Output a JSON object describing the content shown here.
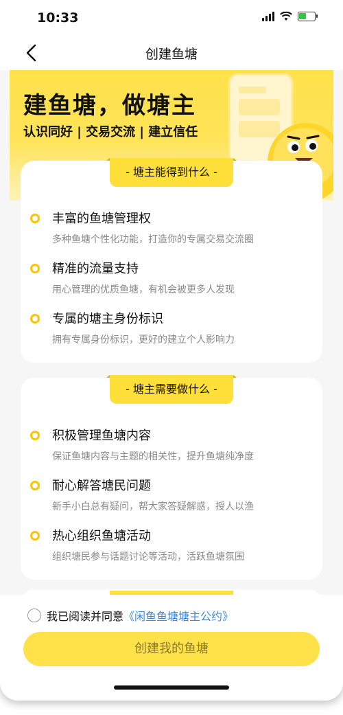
{
  "status": {
    "time": "10:33"
  },
  "nav": {
    "title": "创建鱼塘"
  },
  "banner": {
    "title": "建鱼塘，做塘主",
    "subtitle": "认识同好 | 交易交流 | 建立信任"
  },
  "section1": {
    "tag": "- 塘主能得到什么 -",
    "items": [
      {
        "title": "丰富的鱼塘管理权",
        "desc": "多种鱼塘个性化功能，打造你的专属交易交流圈"
      },
      {
        "title": "精准的流量支持",
        "desc": "用心管理的优质鱼塘，有机会被更多人发现"
      },
      {
        "title": "专属的塘主身份标识",
        "desc": "拥有专属身份标识，更好的建立个人影响力"
      }
    ]
  },
  "section2": {
    "tag": "- 塘主需要做什么 -",
    "items": [
      {
        "title": "积极管理鱼塘内容",
        "desc": "保证鱼塘内容与主题的相关性，提升鱼塘纯净度"
      },
      {
        "title": "耐心解答塘民问题",
        "desc": "新手小白总有疑问，帮大家答疑解惑，授人以渔"
      },
      {
        "title": "热心组织鱼塘活动",
        "desc": "组织塘民参与话题讨论等活动，活跃鱼塘氛围"
      }
    ]
  },
  "footer": {
    "agree_text": "我已阅读并同意",
    "agreement_link": "《闲鱼鱼塘塘主公约》",
    "create_button": "创建我的鱼塘"
  },
  "colors": {
    "accent_yellow": "#ffe03b",
    "dot_yellow": "#ffc400",
    "link_blue": "#3b8ae0"
  }
}
